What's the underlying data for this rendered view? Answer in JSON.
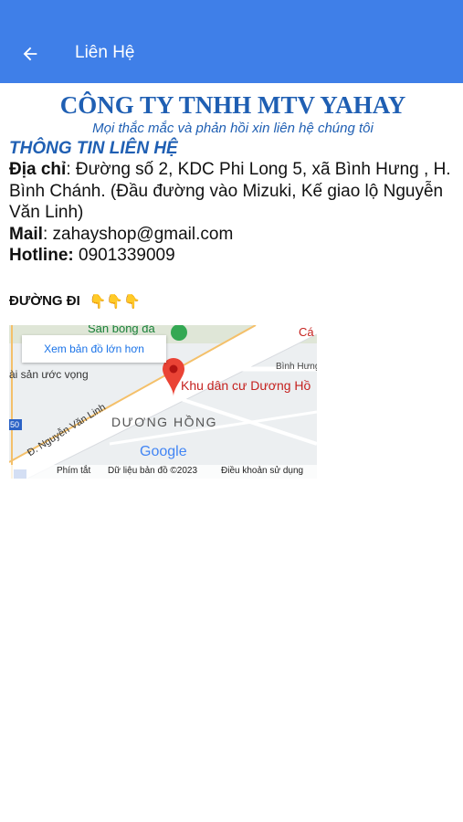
{
  "appbar": {
    "title": "Liên Hệ",
    "back_icon": "arrow-left-icon",
    "color": "#3f7fe8"
  },
  "company": {
    "name": "CÔNG TY TNHH MTV YAHAY",
    "tagline": "Mọi thắc mắc và phản hồi xin liên hệ chúng tôi"
  },
  "contact": {
    "section_title": "THÔNG TIN LIÊN HỆ",
    "address_label": "Địa chỉ",
    "address_value": ": Đường số 2, KDC Phi Long 5, xã Bình Hưng , H. Bình Chánh. (Đầu đường vào Mizuki, Kế giao lộ Nguyễn Văn Linh)",
    "mail_label": "Mail",
    "mail_value": ": zahayshop@gmail.com",
    "hotline_label": "Hotline:",
    "hotline_value": " 0901339009"
  },
  "directions": {
    "label": "ĐƯỜNG ĐI",
    "emoji": "👇👇👇"
  },
  "map": {
    "open_larger": "Xem bản đồ lớn hơn",
    "place_name": "Khu dân cư Dương Hồ",
    "area_label": "DƯƠNG HỒNG",
    "road_label": "Đ. Nguyễn Văn Linh",
    "street_label": "Bình Hưng",
    "poi_left": "ài sản ước vọng",
    "poi_top": "Sân bóng đá",
    "poi_right": "Cá",
    "route_badge": "50",
    "google": "Google",
    "footer_shortcuts": "Phím tắt",
    "footer_data": "Dữ liệu bản đồ ©2023",
    "footer_terms": "Điều khoản sử dụng"
  }
}
